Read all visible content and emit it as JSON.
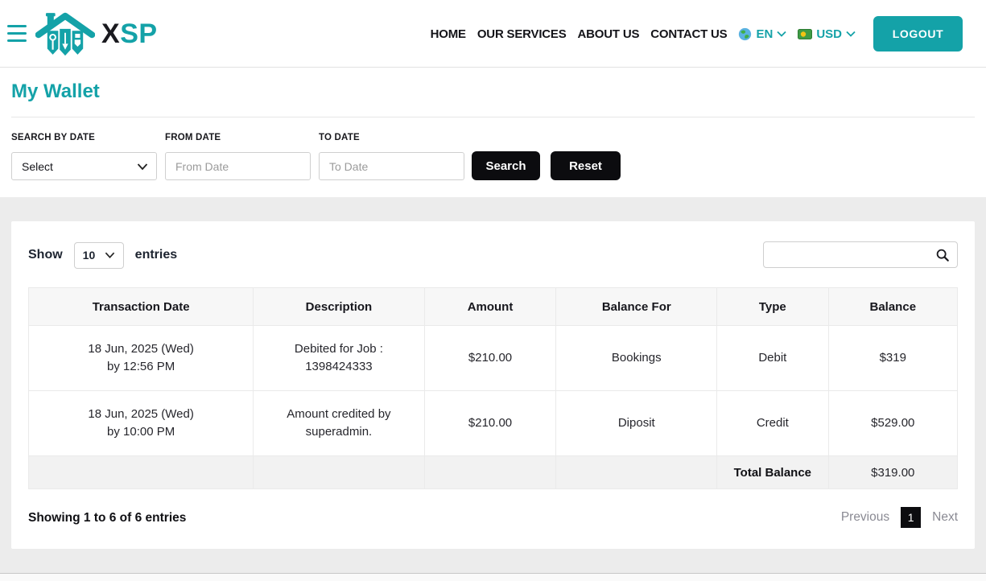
{
  "theme": {
    "teal": "#14a2a8",
    "dark": "#0c0c0f",
    "gray_bg": "#ececec"
  },
  "header": {
    "brand": {
      "x": "X",
      "sp": "SP"
    },
    "nav": [
      "HOME",
      "OUR SERVICES",
      "ABOUT US",
      "CONTACT US"
    ],
    "language": {
      "label": "EN"
    },
    "currency": {
      "label": "USD"
    },
    "logout_label": "LOGOUT"
  },
  "page": {
    "title": "My Wallet"
  },
  "filters": {
    "search_by_date": {
      "label": "SEARCH BY DATE",
      "value": "Select"
    },
    "from_date": {
      "label": "FROM DATE",
      "placeholder": "From Date",
      "value": ""
    },
    "to_date": {
      "label": "TO DATE",
      "placeholder": "To Date",
      "value": ""
    },
    "search_label": "Search",
    "reset_label": "Reset"
  },
  "table": {
    "show_label": "Show",
    "page_size": "10",
    "entries_label": "entries",
    "search_value": "",
    "headers": [
      "Transaction Date",
      "Description",
      "Amount",
      "Balance For",
      "Type",
      "Balance"
    ],
    "rows": [
      {
        "date_line1": "18 Jun, 2025 (Wed)",
        "date_line2": "by 12:56 PM",
        "desc_line1": "Debited for Job :",
        "desc_line2": "1398424333",
        "amount": "$210.00",
        "balance_for": "Bookings",
        "type": "Debit",
        "balance": "$319"
      },
      {
        "date_line1": "18 Jun, 2025 (Wed)",
        "date_line2": "by 10:00 PM",
        "desc_line1": "Amount credited by",
        "desc_line2": "superadmin.",
        "amount": "$210.00",
        "balance_for": "Diposit",
        "type": "Credit",
        "balance": "$529.00"
      }
    ],
    "total": {
      "label": "Total Balance",
      "value": "$319.00"
    },
    "footer_info": "Showing 1 to 6 of 6 entries",
    "pagination": {
      "previous": "Previous",
      "current": "1",
      "next": "Next"
    }
  }
}
